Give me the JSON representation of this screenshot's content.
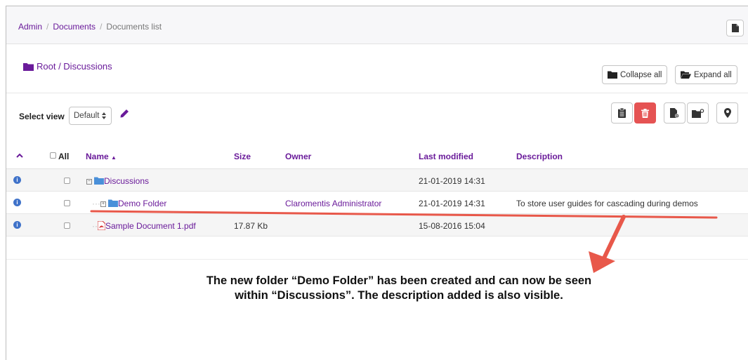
{
  "breadcrumb": {
    "items": [
      "Admin",
      "Documents",
      "Documents list"
    ]
  },
  "path": {
    "label": "Root / Discussions"
  },
  "buttons": {
    "collapse_all": "Collapse all",
    "expand_all": "Expand all"
  },
  "view": {
    "label": "Select view",
    "selected": "Default"
  },
  "table": {
    "columns": {
      "all": "All",
      "name": "Name",
      "size": "Size",
      "owner": "Owner",
      "last_modified": "Last modified",
      "description": "Description"
    },
    "rows": [
      {
        "name": "Discussions",
        "size": "",
        "owner": "",
        "last_modified": "21-01-2019 14:31",
        "description": ""
      },
      {
        "name": "Demo Folder",
        "size": "",
        "owner": "Claromentis Administrator",
        "last_modified": "21-01-2019 14:31",
        "description": "To store user guides for cascading during demos"
      },
      {
        "name": "Sample Document 1.pdf",
        "size": "17.87 Kb",
        "owner": "",
        "last_modified": "15-08-2016 15:04",
        "description": ""
      }
    ]
  },
  "annotation": {
    "text": "The new folder “Demo Folder” has been created and can now be seen within “Discussions”. The description added is also visible.",
    "color": "#e8584a"
  },
  "colors": {
    "accent": "#6a1b9a",
    "danger": "#e55353",
    "info": "#3f72c9"
  }
}
